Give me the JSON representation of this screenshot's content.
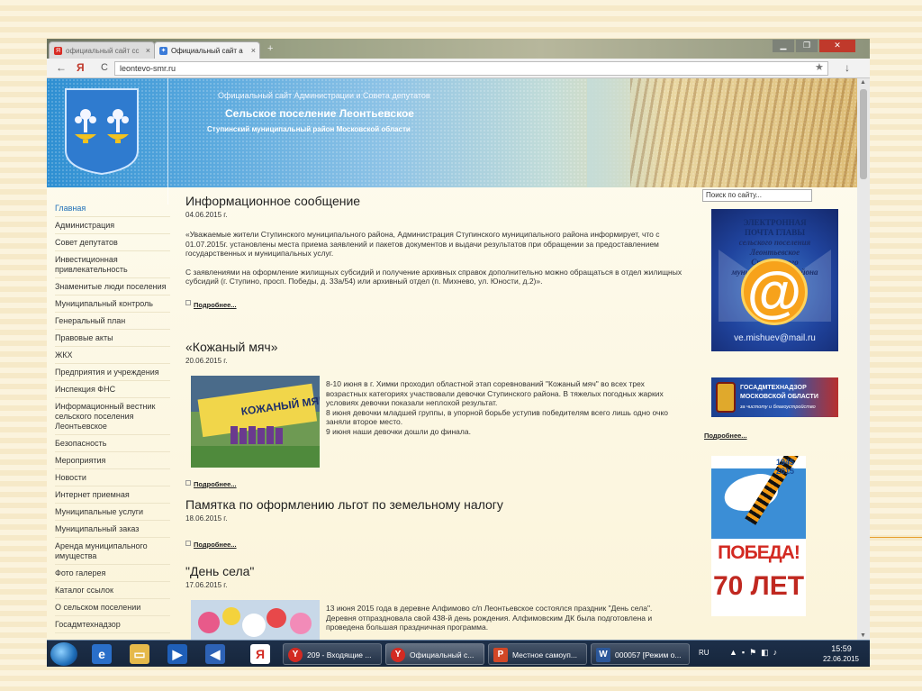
{
  "browser": {
    "tabs": [
      {
        "label": "официальный сайт сс",
        "icon": "yandex-icon"
      },
      {
        "label": "Официальный сайт а",
        "icon": "site-icon"
      }
    ],
    "new_tab": "+",
    "nav_back": "←",
    "nav_yandex": "Я",
    "nav_reload": "C",
    "url": "leontevo-smr.ru",
    "bookmark": "★",
    "download": "↓"
  },
  "header": {
    "line1": "Официальный сайт Администрации и Совета депутатов",
    "line2": "Сельское поселение Леонтьевское",
    "line3": "Ступинский муниципальный район Московской области"
  },
  "search": {
    "placeholder": "Поиск по сайту..."
  },
  "sidebar": {
    "items": [
      "Главная",
      "Администрация",
      "Совет депутатов",
      "Инвестиционная привлекательность",
      "Знаменитые люди поселения",
      "Муниципальный контроль",
      "Генеральный план",
      "Правовые акты",
      "ЖКХ",
      "Предприятия и учреждения",
      "Инспекция ФНС",
      "Информационный вестник сельского поселения Леонтьевское",
      "Безопасность",
      "Мероприятия",
      "Новости",
      "Интернет приемная",
      "Муниципальные услуги",
      "Муниципальный заказ",
      "Аренда муниципального имущества",
      "Фото галерея",
      "Каталог ссылок",
      "О сельском поселении",
      "Госадмтехнадзор"
    ]
  },
  "articles": [
    {
      "title": "Информационное сообщение",
      "date": "04.06.2015 г.",
      "p1": "«Уважаемые жители Ступинского муниципального района, Администрация Ступинского муниципального района информирует, что с 01.07.2015г. установлены места приема заявлений и пакетов документов и выдачи результатов при обращении за предоставлением государственных и муниципальных услуг.",
      "p2": "С заявлениями на оформление жилищных субсидий и получение архивных справок дополнительно можно обращаться в отдел жилищных субсидий (г. Ступино, просп. Победы, д. 33а/54) или архивный отдел (п. Михнево, ул. Юности, д.2)».",
      "more": "Подробнее..."
    },
    {
      "title": "«Кожаный мяч»",
      "date": "20.06.2015 г.",
      "p1": "8-10 июня в г. Химки проходил областной этап соревнований \"Кожаный мяч\" во всех трех возрастных категориях участвовали девочки Ступинского района. В тяжелых погодных жарких условиях девочки показали неплохой результат.",
      "p2": "8 июня девочки младшей группы, в упорной борьбе уступив победителям всего лишь одно очко заняли второе место.",
      "p3": "9 июня наши девочки дошли до финала.",
      "image_caption": "КОЖАНЫЙ МЯЧ",
      "more": "Подробнее..."
    },
    {
      "title": "Памятка по оформлению льгот по земельному налогу",
      "date": "18.06.2015 г.",
      "more": "Подробнее..."
    },
    {
      "title": "\"День села\"",
      "date": "17.06.2015 г.",
      "p1": "13 июня 2015 года в деревне Алфимово с/п Леонтьевское состоялся праздник \"День села\". Деревня отпраздновала свой 438-й день рождения. Алфимовским ДК была подготовлена и проведена большая праздничная программа."
    }
  ],
  "right": {
    "mail_banner": {
      "line1": "ЭЛЕКТРОННАЯ",
      "line2": "ПОЧТА ГЛАВЫ",
      "line3": "сельского поселения",
      "line4": "Леонтьевское",
      "line5": "Ступинского",
      "line6": "муниципального района",
      "email": "ve.mishuev@mail.ru",
      "at": "@"
    },
    "gos_banner": {
      "line1": "ГОСАДМТЕХНАДЗОР",
      "line2": "МОСКОВСКОЙ ОБЛАСТИ",
      "line3": "за чистоту и благоустройство"
    },
    "gos_more": "Подробнее...",
    "victory": {
      "year1": "1945",
      "year2": "2015",
      "pobeda": "ПОБЕДА!",
      "seventy": "70 ЛЕТ"
    }
  },
  "taskbar": {
    "tasks": [
      {
        "label": "209 - Входящие ...",
        "icon": "yandex-browser-icon",
        "color": "#d32a22",
        "glyph": "Y"
      },
      {
        "label": "Официальный с...",
        "icon": "yandex-browser-icon",
        "color": "#d32a22",
        "glyph": "Y"
      },
      {
        "label": "Местное самоуп...",
        "icon": "powerpoint-icon",
        "color": "#d24726",
        "glyph": "P"
      },
      {
        "label": "000057 [Режим о...",
        "icon": "word-icon",
        "color": "#2b579a",
        "glyph": "W"
      }
    ],
    "lang": "RU",
    "time": "15:59",
    "date": "22.06.2015"
  },
  "colors": {
    "accent_blue": "#2e8fd2",
    "active_link": "#1f6fb8",
    "victory_red": "#d32a22"
  }
}
